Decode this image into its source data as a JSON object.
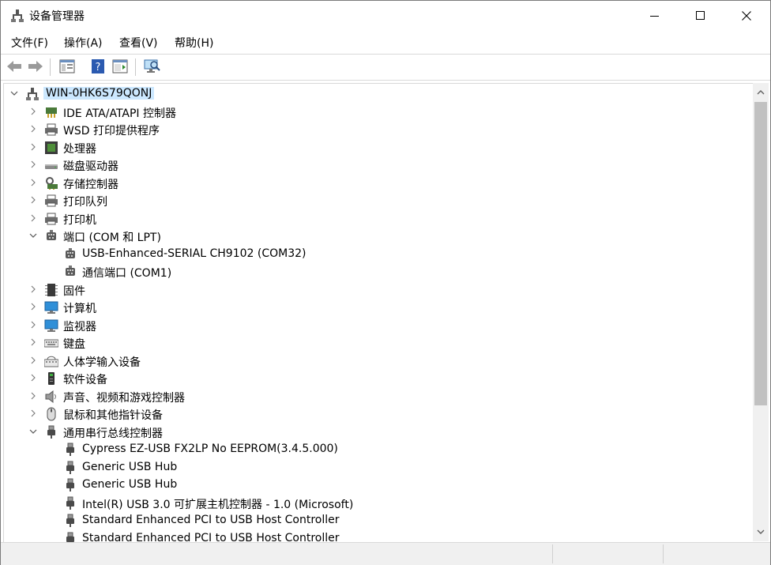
{
  "window": {
    "title": "设备管理器"
  },
  "menu": [
    {
      "label": "文件(F)"
    },
    {
      "label": "操作(A)"
    },
    {
      "label": "查看(V)"
    },
    {
      "label": "帮助(H)"
    }
  ],
  "tree": {
    "root": "WIN-0HK6S79QONJ",
    "categories": [
      {
        "label": "IDE ATA/ATAPI 控制器",
        "icon": "ide-controller-icon"
      },
      {
        "label": "WSD 打印提供程序",
        "icon": "printer-icon"
      },
      {
        "label": "处理器",
        "icon": "processor-icon"
      },
      {
        "label": "磁盘驱动器",
        "icon": "disk-drive-icon"
      },
      {
        "label": "存储控制器",
        "icon": "storage-controller-icon"
      },
      {
        "label": "打印队列",
        "icon": "printer-icon"
      },
      {
        "label": "打印机",
        "icon": "printer-icon"
      },
      {
        "label": "端口 (COM 和 LPT)",
        "icon": "port-icon"
      },
      {
        "label": "USB-Enhanced-SERIAL CH9102 (COM32)",
        "icon": "port-icon"
      },
      {
        "label": "通信端口 (COM1)",
        "icon": "port-icon"
      },
      {
        "label": "固件",
        "icon": "firmware-icon"
      },
      {
        "label": "计算机",
        "icon": "monitor-icon"
      },
      {
        "label": "监视器",
        "icon": "monitor-icon"
      },
      {
        "label": "键盘",
        "icon": "keyboard-icon"
      },
      {
        "label": "人体学输入设备",
        "icon": "hid-icon"
      },
      {
        "label": "软件设备",
        "icon": "software-device-icon"
      },
      {
        "label": "声音、视频和游戏控制器",
        "icon": "speaker-icon"
      },
      {
        "label": "鼠标和其他指针设备",
        "icon": "mouse-icon"
      },
      {
        "label": "通用串行总线控制器",
        "icon": "usb-icon"
      },
      {
        "label": "Cypress EZ-USB FX2LP No EEPROM(3.4.5.000)",
        "icon": "usb-icon"
      },
      {
        "label": "Generic USB Hub",
        "icon": "usb-icon"
      },
      {
        "label": "Generic USB Hub",
        "icon": "usb-icon"
      },
      {
        "label": "Intel(R) USB 3.0 可扩展主机控制器 - 1.0 (Microsoft)",
        "icon": "usb-icon"
      },
      {
        "label": "Standard Enhanced PCI to USB Host Controller",
        "icon": "usb-icon"
      },
      {
        "label": "Standard Enhanced PCI to USB Host Controller",
        "icon": "usb-icon"
      }
    ]
  }
}
